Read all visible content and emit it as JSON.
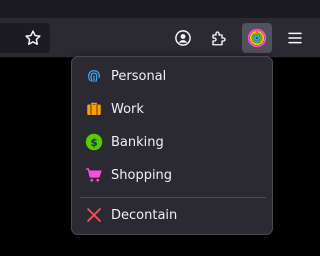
{
  "toolbar": {
    "icons": [
      "star-icon",
      "account-icon",
      "extensions-icon",
      "container-fingerprint-icon",
      "hamburger-menu-icon"
    ],
    "active_color": "#52525e"
  },
  "panel": {
    "containers": [
      {
        "label": "Personal",
        "icon": "fingerprint-icon",
        "color": "#37adff"
      },
      {
        "label": "Work",
        "icon": "briefcase-icon",
        "color": "#ff9f00"
      },
      {
        "label": "Banking",
        "icon": "dollar-icon",
        "color": "#51cd00"
      },
      {
        "label": "Shopping",
        "icon": "cart-icon",
        "color": "#ff4bda"
      }
    ],
    "decontain": {
      "label": "Decontain",
      "icon": "close-icon",
      "color": "#ff4f5e"
    }
  }
}
